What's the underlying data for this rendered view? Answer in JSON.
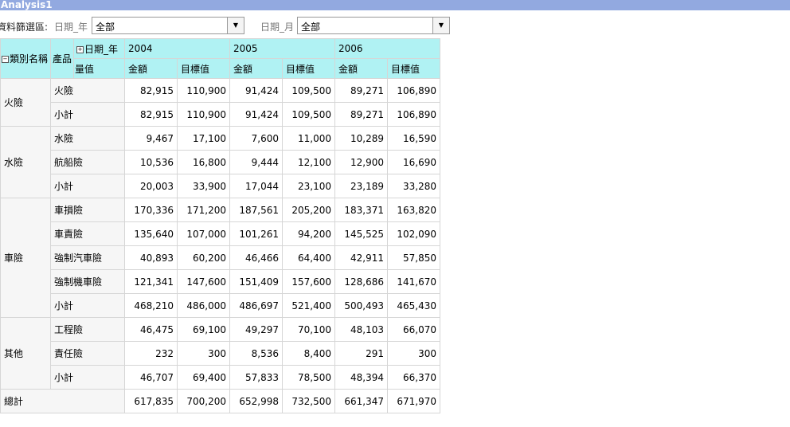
{
  "window": {
    "title": "Analysis1"
  },
  "filters": {
    "label": "資料篩選區:",
    "year": {
      "name": "日期_年",
      "value": "全部"
    },
    "month": {
      "name": "日期_月",
      "value": "全部"
    }
  },
  "pivot": {
    "row_field_1": "類別名稱",
    "row_field_2": "產品",
    "col_field": "日期_年",
    "measure_label": "量值",
    "years": [
      "2004",
      "2005",
      "2006"
    ],
    "measures": [
      "金額",
      "目標值"
    ],
    "expand_symbol": "⊟",
    "collapse_symbol": "⊞",
    "rows": [
      {
        "category": "火險",
        "product": "火險",
        "values": [
          "82,915",
          "110,900",
          "91,424",
          "109,500",
          "89,271",
          "106,890"
        ]
      },
      {
        "category": "",
        "product": "小計",
        "values": [
          "82,915",
          "110,900",
          "91,424",
          "109,500",
          "89,271",
          "106,890"
        ]
      },
      {
        "category": "水險",
        "product": "水險",
        "values": [
          "9,467",
          "17,100",
          "7,600",
          "11,000",
          "10,289",
          "16,590"
        ]
      },
      {
        "category": "",
        "product": "航船險",
        "values": [
          "10,536",
          "16,800",
          "9,444",
          "12,100",
          "12,900",
          "16,690"
        ]
      },
      {
        "category": "",
        "product": "小計",
        "values": [
          "20,003",
          "33,900",
          "17,044",
          "23,100",
          "23,189",
          "33,280"
        ]
      },
      {
        "category": "車險",
        "product": "車損險",
        "values": [
          "170,336",
          "171,200",
          "187,561",
          "205,200",
          "183,371",
          "163,820"
        ]
      },
      {
        "category": "",
        "product": "車責險",
        "values": [
          "135,640",
          "107,000",
          "101,261",
          "94,200",
          "145,525",
          "102,090"
        ]
      },
      {
        "category": "",
        "product": "強制汽車險",
        "values": [
          "40,893",
          "60,200",
          "46,466",
          "64,400",
          "42,911",
          "57,850"
        ]
      },
      {
        "category": "",
        "product": "強制機車險",
        "values": [
          "121,341",
          "147,600",
          "151,409",
          "157,600",
          "128,686",
          "141,670"
        ]
      },
      {
        "category": "",
        "product": "小計",
        "values": [
          "468,210",
          "486,000",
          "486,697",
          "521,400",
          "500,493",
          "465,430"
        ]
      },
      {
        "category": "其他",
        "product": "工程險",
        "values": [
          "46,475",
          "69,100",
          "49,297",
          "70,100",
          "48,103",
          "66,070"
        ]
      },
      {
        "category": "",
        "product": "責任險",
        "values": [
          "232",
          "300",
          "8,536",
          "8,400",
          "291",
          "300"
        ]
      },
      {
        "category": "",
        "product": "小計",
        "values": [
          "46,707",
          "69,400",
          "57,833",
          "78,500",
          "48,394",
          "66,370"
        ]
      }
    ],
    "total": {
      "label": "總計",
      "values": [
        "617,835",
        "700,200",
        "652,998",
        "732,500",
        "661,347",
        "671,970"
      ]
    }
  }
}
